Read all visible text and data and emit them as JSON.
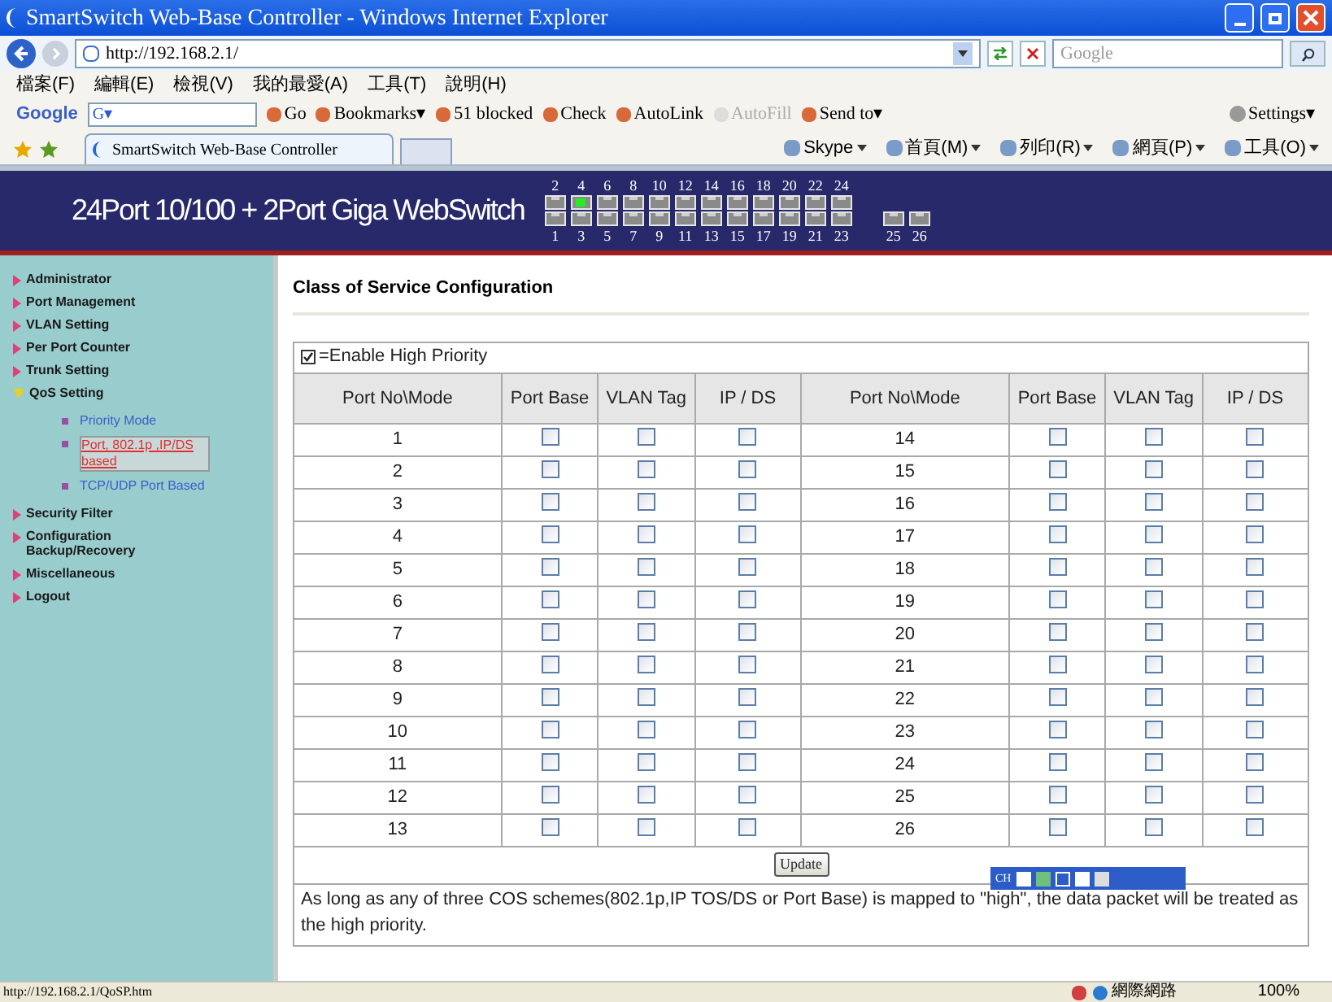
{
  "window": {
    "title": "SmartSwitch Web-Base Controller - Windows Internet Explorer"
  },
  "address_bar": {
    "url": "http://192.168.2.1/",
    "search_placeholder": "Google"
  },
  "menu_bar": [
    "檔案(F)",
    "編輯(E)",
    "檢視(V)",
    "我的最愛(A)",
    "工具(T)",
    "說明(H)"
  ],
  "google_toolbar": {
    "logo": "Google",
    "field_value": "G▾",
    "items": [
      {
        "label": "Go",
        "disabled": false
      },
      {
        "label": "Bookmarks▾",
        "disabled": false
      },
      {
        "label": "51 blocked",
        "disabled": false
      },
      {
        "label": "Check",
        "disabled": false
      },
      {
        "label": "AutoLink",
        "disabled": false
      },
      {
        "label": "AutoFill",
        "disabled": true
      },
      {
        "label": "Send to▾",
        "disabled": false
      }
    ],
    "settings": "Settings▾"
  },
  "tab": {
    "title": "SmartSwitch Web-Base Controller"
  },
  "command_bar": [
    "Skype",
    "首頁(M)",
    "列印(R)",
    "網頁(P)",
    "工具(O)"
  ],
  "banner": {
    "title": "24Port 10/100 + 2Port Giga WebSwitch",
    "port_columns": [
      {
        "top": {
          "label": "2",
          "link": false
        },
        "bottom": {
          "label": "1",
          "link": false
        }
      },
      {
        "top": {
          "label": "4",
          "link": true
        },
        "bottom": {
          "label": "3",
          "link": false
        }
      },
      {
        "top": {
          "label": "6",
          "link": false
        },
        "bottom": {
          "label": "5",
          "link": false
        }
      },
      {
        "top": {
          "label": "8",
          "link": false
        },
        "bottom": {
          "label": "7",
          "link": false
        }
      },
      {
        "top": {
          "label": "10",
          "link": false
        },
        "bottom": {
          "label": "9",
          "link": false
        }
      },
      {
        "top": {
          "label": "12",
          "link": false
        },
        "bottom": {
          "label": "11",
          "link": false
        }
      },
      {
        "top": {
          "label": "14",
          "link": false
        },
        "bottom": {
          "label": "13",
          "link": false
        }
      },
      {
        "top": {
          "label": "16",
          "link": false
        },
        "bottom": {
          "label": "15",
          "link": false
        }
      },
      {
        "top": {
          "label": "18",
          "link": false
        },
        "bottom": {
          "label": "17",
          "link": false
        }
      },
      {
        "top": {
          "label": "20",
          "link": false
        },
        "bottom": {
          "label": "19",
          "link": false
        }
      },
      {
        "top": {
          "label": "22",
          "link": false
        },
        "bottom": {
          "label": "21",
          "link": false
        }
      },
      {
        "top": {
          "label": "24",
          "link": false
        },
        "bottom": {
          "label": "23",
          "link": false
        }
      }
    ],
    "giga_ports": [
      {
        "label": "25",
        "link": false
      },
      {
        "label": "26",
        "link": false
      }
    ]
  },
  "sidebar": {
    "items": [
      {
        "label": "Administrator",
        "expanded": false
      },
      {
        "label": "Port Management",
        "expanded": false
      },
      {
        "label": "VLAN Setting",
        "expanded": false
      },
      {
        "label": "Per Port Counter",
        "expanded": false
      },
      {
        "label": "Trunk Setting",
        "expanded": false
      },
      {
        "label": "QoS Setting",
        "expanded": true,
        "children": [
          {
            "label": "Priority Mode",
            "selected": false
          },
          {
            "label": "Port, 802.1p ,IP/DS based",
            "selected": true
          },
          {
            "label": "TCP/UDP Port Based",
            "selected": false
          }
        ]
      },
      {
        "label": "Security Filter",
        "expanded": false
      },
      {
        "label": "Configuration Backup/Recovery",
        "expanded": false
      },
      {
        "label": "Miscellaneous",
        "expanded": false
      },
      {
        "label": "Logout",
        "expanded": false
      }
    ]
  },
  "page_title": "Class of Service Configuration",
  "legend": {
    "label": "=Enable High Priority",
    "checked": true
  },
  "table": {
    "columns": [
      "Port No\\Mode",
      "Port Base",
      "VLAN Tag",
      "IP / DS",
      "Port No\\Mode",
      "Port Base",
      "VLAN Tag",
      "IP / DS"
    ],
    "rows": [
      {
        "left": {
          "port": "1",
          "port_base": false,
          "vlan_tag": false,
          "ip_ds": false
        },
        "right": {
          "port": "14",
          "port_base": false,
          "vlan_tag": false,
          "ip_ds": false
        }
      },
      {
        "left": {
          "port": "2",
          "port_base": false,
          "vlan_tag": false,
          "ip_ds": false
        },
        "right": {
          "port": "15",
          "port_base": false,
          "vlan_tag": false,
          "ip_ds": false
        }
      },
      {
        "left": {
          "port": "3",
          "port_base": false,
          "vlan_tag": false,
          "ip_ds": false
        },
        "right": {
          "port": "16",
          "port_base": false,
          "vlan_tag": false,
          "ip_ds": false
        }
      },
      {
        "left": {
          "port": "4",
          "port_base": false,
          "vlan_tag": false,
          "ip_ds": false
        },
        "right": {
          "port": "17",
          "port_base": false,
          "vlan_tag": false,
          "ip_ds": false
        }
      },
      {
        "left": {
          "port": "5",
          "port_base": false,
          "vlan_tag": false,
          "ip_ds": false
        },
        "right": {
          "port": "18",
          "port_base": false,
          "vlan_tag": false,
          "ip_ds": false
        }
      },
      {
        "left": {
          "port": "6",
          "port_base": false,
          "vlan_tag": false,
          "ip_ds": false
        },
        "right": {
          "port": "19",
          "port_base": false,
          "vlan_tag": false,
          "ip_ds": false
        }
      },
      {
        "left": {
          "port": "7",
          "port_base": false,
          "vlan_tag": false,
          "ip_ds": false
        },
        "right": {
          "port": "20",
          "port_base": false,
          "vlan_tag": false,
          "ip_ds": false
        }
      },
      {
        "left": {
          "port": "8",
          "port_base": false,
          "vlan_tag": false,
          "ip_ds": false
        },
        "right": {
          "port": "21",
          "port_base": false,
          "vlan_tag": false,
          "ip_ds": false
        }
      },
      {
        "left": {
          "port": "9",
          "port_base": false,
          "vlan_tag": false,
          "ip_ds": false
        },
        "right": {
          "port": "22",
          "port_base": false,
          "vlan_tag": false,
          "ip_ds": false
        }
      },
      {
        "left": {
          "port": "10",
          "port_base": false,
          "vlan_tag": false,
          "ip_ds": false
        },
        "right": {
          "port": "23",
          "port_base": false,
          "vlan_tag": false,
          "ip_ds": false
        }
      },
      {
        "left": {
          "port": "11",
          "port_base": false,
          "vlan_tag": false,
          "ip_ds": false
        },
        "right": {
          "port": "24",
          "port_base": false,
          "vlan_tag": false,
          "ip_ds": false
        }
      },
      {
        "left": {
          "port": "12",
          "port_base": false,
          "vlan_tag": false,
          "ip_ds": false
        },
        "right": {
          "port": "25",
          "port_base": false,
          "vlan_tag": false,
          "ip_ds": false
        }
      },
      {
        "left": {
          "port": "13",
          "port_base": false,
          "vlan_tag": false,
          "ip_ds": false
        },
        "right": {
          "port": "26",
          "port_base": false,
          "vlan_tag": false,
          "ip_ds": false
        }
      }
    ]
  },
  "update_button": "Update",
  "note": "As long as any of three COS schemes(802.1p,IP TOS/DS or Port Base) is mapped to \"high\", the data packet will be treated as the high priority.",
  "ime_bar": {
    "label": "CH"
  },
  "status_bar": {
    "url": "http://192.168.2.1/QoSP.htm",
    "zone": "網際網路",
    "zoom": "100%"
  }
}
